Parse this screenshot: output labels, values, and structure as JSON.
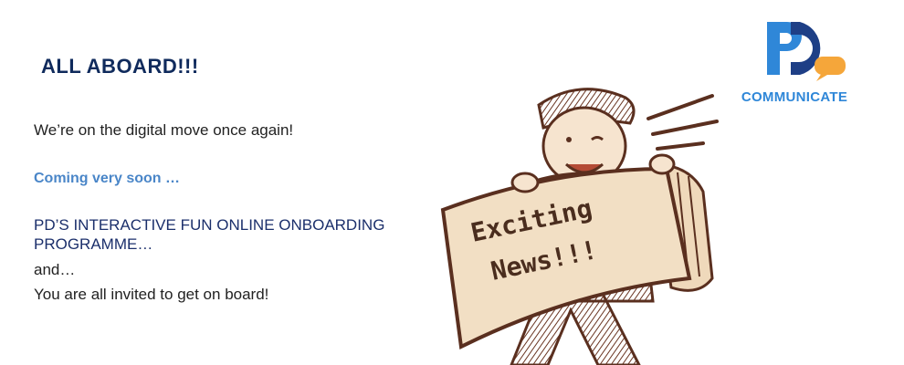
{
  "headline": "ALL ABOARD!!!",
  "intro": "We’re on the digital move once again!",
  "coming": "Coming very soon …",
  "programme": "PD’S INTERACTIVE FUN ONLINE ONBOARDING PROGRAMME…",
  "and": "and…",
  "invite": "You are all invited to get on board!",
  "logo": {
    "word": "COMMUNICATE"
  },
  "sign": {
    "line1": "Exciting",
    "line2": "News!!!"
  },
  "colors": {
    "headline": "#0f2a5c",
    "accent_blue": "#4a86c8",
    "logo_blue": "#2f87d8",
    "logo_navy": "#1e3f86",
    "bubble_orange": "#f5a63a",
    "ink": "#5a2f1f",
    "paper": "#f2dfc4"
  },
  "icons": [
    "pd-logo-icon",
    "speech-bubble-icon",
    "newsboy-illustration"
  ]
}
